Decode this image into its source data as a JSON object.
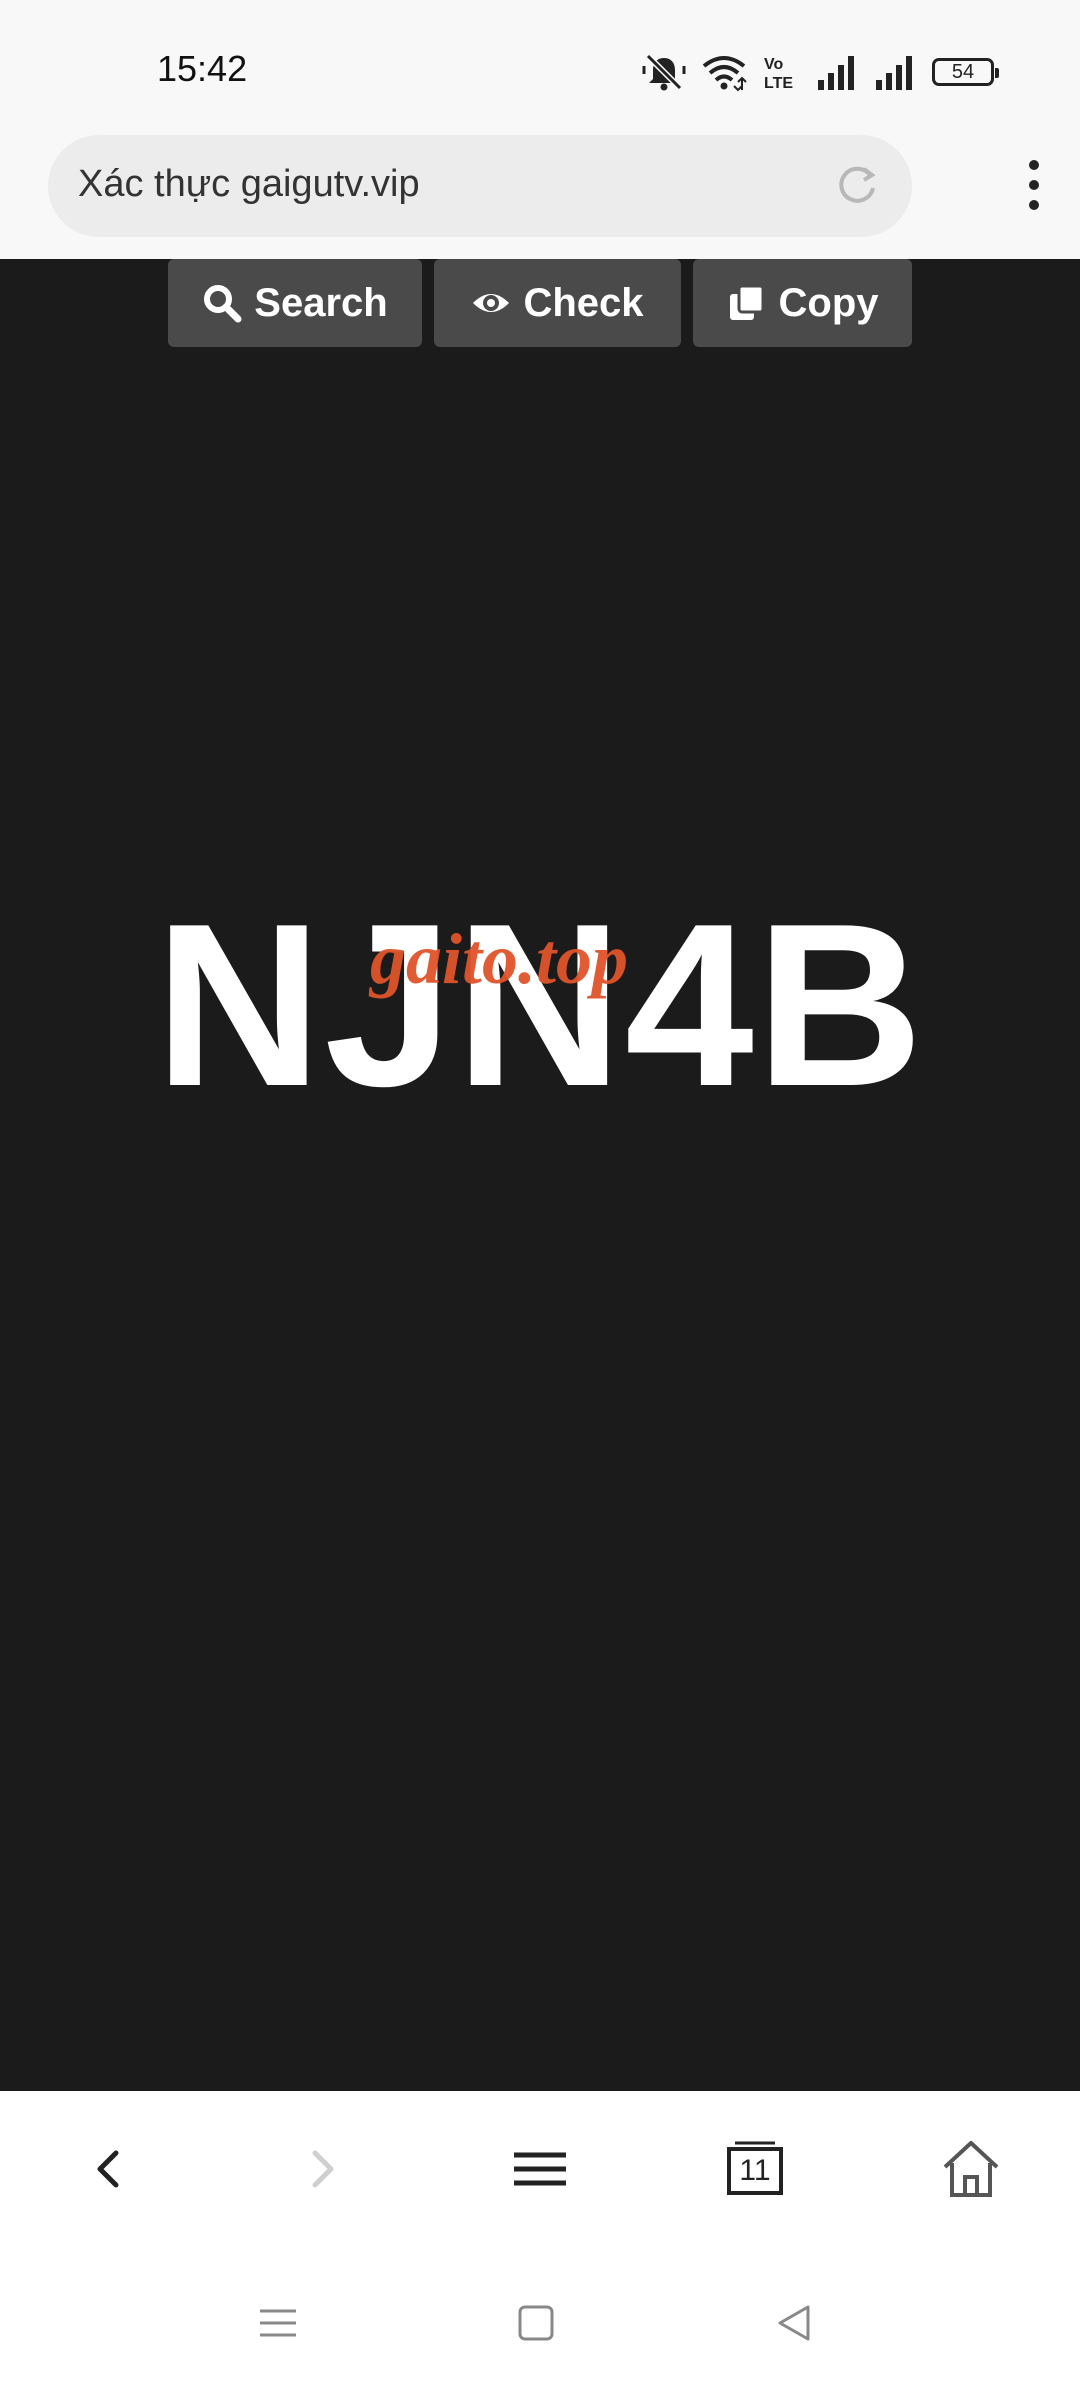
{
  "status_bar": {
    "time": "15:42",
    "battery": "54",
    "volte": "Vo LTE",
    "icons": [
      "mute-icon",
      "wifi-icon",
      "volte-icon",
      "signal-icon",
      "signal-icon",
      "battery-icon"
    ]
  },
  "browser": {
    "url_title": "Xác thực gaigutv.vip",
    "icons": [
      "reload-icon",
      "more-options-icon"
    ]
  },
  "toolbar": {
    "search_label": "Search",
    "check_label": "Check",
    "copy_label": "Copy"
  },
  "content": {
    "code": "NJN4B",
    "watermark": "gaito.top"
  },
  "bottom_nav": {
    "tab_count": "11",
    "icons": [
      "back-icon",
      "forward-icon",
      "menu-icon",
      "tabs-icon",
      "home-icon"
    ]
  },
  "system_nav": {
    "icons": [
      "recents-icon",
      "home-square-icon",
      "back-triangle-icon"
    ]
  },
  "colors": {
    "background": "#1b1b1b",
    "button": "#4a4a4a",
    "watermark": "#e0542b",
    "bar": "#f8f8f8"
  }
}
